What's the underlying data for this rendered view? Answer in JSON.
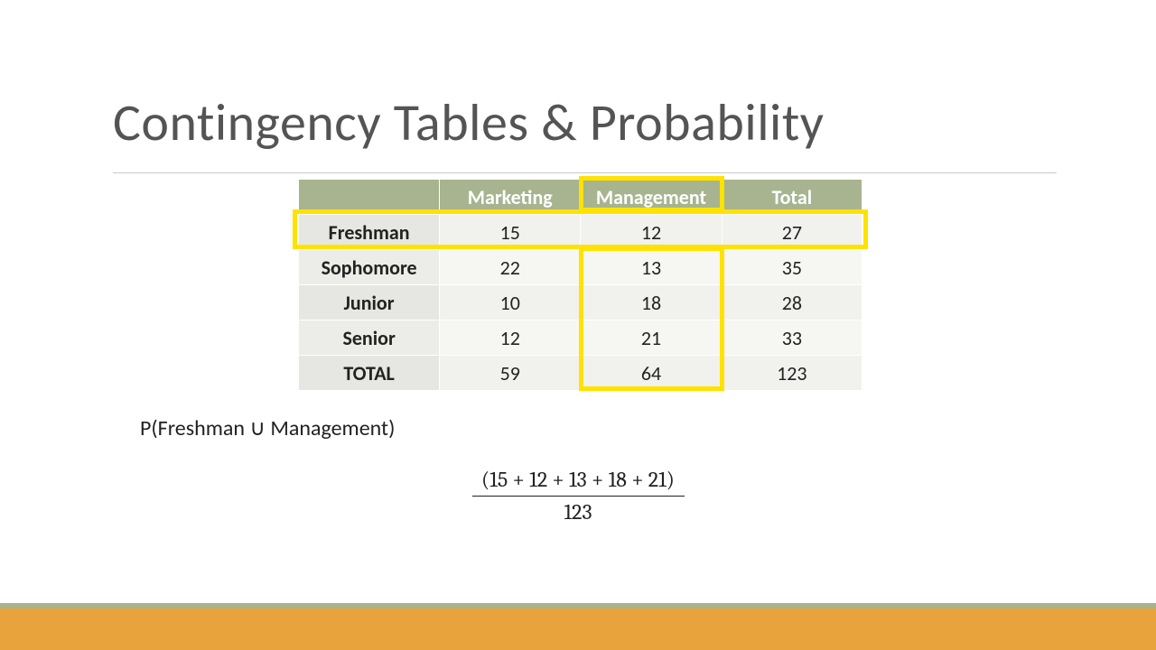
{
  "title": "Contingency Tables & Probability",
  "table": {
    "headers": {
      "c1": "Marketing",
      "c2": "Management",
      "c3": "Total"
    },
    "rows": [
      {
        "label": "Freshman",
        "c1": "15",
        "c2": "12",
        "c3": "27"
      },
      {
        "label": "Sophomore",
        "c1": "22",
        "c2": "13",
        "c3": "35"
      },
      {
        "label": "Junior",
        "c1": "10",
        "c2": "18",
        "c3": "28"
      },
      {
        "label": "Senior",
        "c1": "12",
        "c2": "21",
        "c3": "33"
      },
      {
        "label": "TOTAL",
        "c1": "59",
        "c2": "64",
        "c3": "123"
      }
    ]
  },
  "formula": {
    "label": "P(Freshman ∪ Management)",
    "numerator": "(15 + 12 + 13 + 18 + 21)",
    "denominator": "123"
  },
  "chart_data": {
    "type": "table",
    "title": "Contingency Tables & Probability",
    "row_labels": [
      "Freshman",
      "Sophomore",
      "Junior",
      "Senior",
      "TOTAL"
    ],
    "col_labels": [
      "Marketing",
      "Management",
      "Total"
    ],
    "cells": [
      [
        15,
        12,
        27
      ],
      [
        22,
        13,
        35
      ],
      [
        10,
        18,
        28
      ],
      [
        12,
        21,
        33
      ],
      [
        59,
        64,
        123
      ]
    ],
    "highlight": {
      "row": "Freshman",
      "column": "Management",
      "probability_expression": "P(Freshman ∪ Management) = (15 + 12 + 13 + 18 + 21) / 123"
    }
  }
}
